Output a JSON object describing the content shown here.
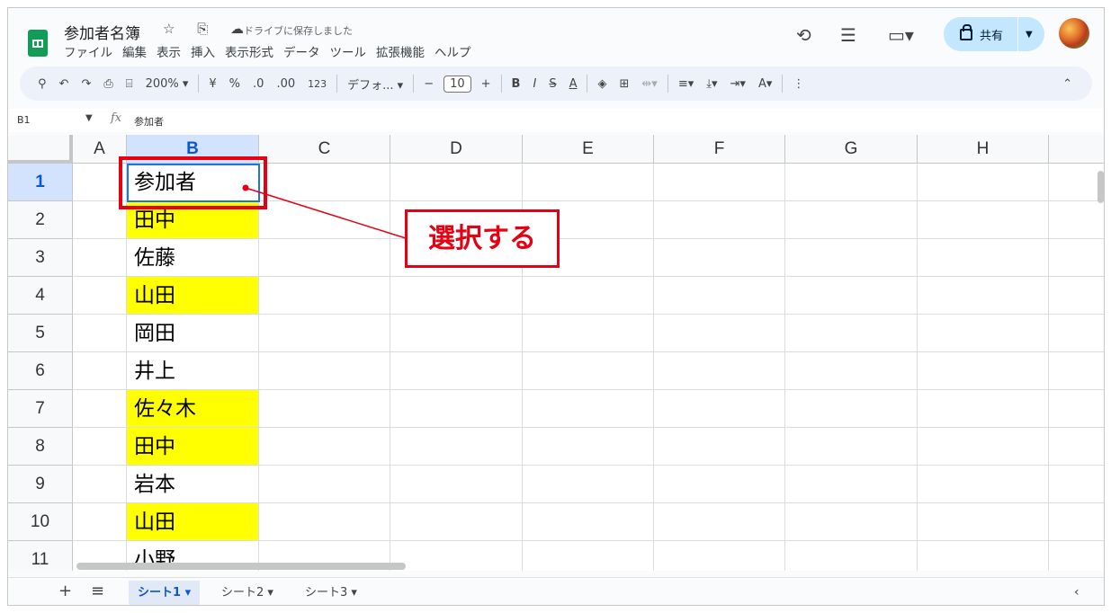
{
  "header": {
    "title": "参加者名簿",
    "title_icons": "☆ ⎘ ☁",
    "saved_status": "ドライブに保存しました",
    "menu": [
      "ファイル",
      "編集",
      "表示",
      "挿入",
      "表示形式",
      "データ",
      "ツール",
      "拡張機能",
      "ヘルプ"
    ],
    "share_label": "共有"
  },
  "toolbar": {
    "zoom": "200% ▾",
    "format_percent": "%",
    "format_currency": "¥",
    "dec_decrease": ".0",
    "dec_increase": ".00",
    "format_123": "123",
    "font": "デフォ... ▾",
    "font_size": "10",
    "bold": "B",
    "italic": "I",
    "strike": "S",
    "text_color": "A"
  },
  "formula_bar": {
    "cell_ref": "B1",
    "content": "参加者"
  },
  "grid": {
    "columns": [
      "A",
      "B",
      "C",
      "D",
      "E",
      "F",
      "G",
      "H"
    ],
    "selected_column": "B",
    "rows": [
      {
        "num": "1",
        "b": "参加者",
        "highlight": false
      },
      {
        "num": "2",
        "b": "田中",
        "highlight": true
      },
      {
        "num": "3",
        "b": "佐藤",
        "highlight": false
      },
      {
        "num": "4",
        "b": "山田",
        "highlight": true
      },
      {
        "num": "5",
        "b": "岡田",
        "highlight": false
      },
      {
        "num": "6",
        "b": "井上",
        "highlight": false
      },
      {
        "num": "7",
        "b": "佐々木",
        "highlight": true
      },
      {
        "num": "8",
        "b": "田中",
        "highlight": true
      },
      {
        "num": "9",
        "b": "岩本",
        "highlight": false
      },
      {
        "num": "10",
        "b": "山田",
        "highlight": true
      },
      {
        "num": "11",
        "b": "小野",
        "highlight": false
      }
    ],
    "highlight_color": "#ffff00"
  },
  "annotation": {
    "callout_text": "選択する",
    "color": "#e60012"
  },
  "sheets": {
    "tabs": [
      "シート1 ▾",
      "シート2 ▾",
      "シート3 ▾"
    ],
    "active": 0
  }
}
